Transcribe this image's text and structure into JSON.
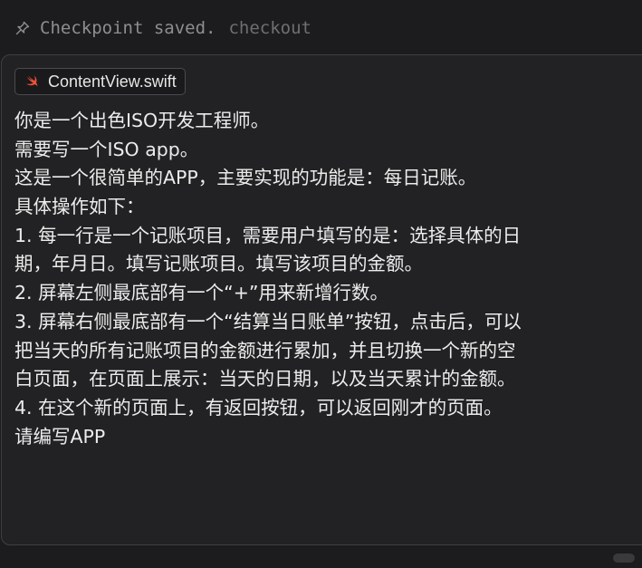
{
  "checkpoint": {
    "icon": "pin-icon",
    "text": "Checkpoint saved.",
    "link_label": "checkout"
  },
  "file_chip": {
    "icon": "swift-icon",
    "name": "ContentView.swift",
    "icon_color": "#f05138"
  },
  "prompt": {
    "lines": [
      "你是一个出色ISO开发工程师。",
      "需要写一个ISO app。",
      "这是一个很简单的APP，主要实现的功能是：每日记账。",
      "具体操作如下：",
      "1. 每一行是一个记账项目，需要用户填写的是：选择具体的日",
      "期，年月日。填写记账项目。填写该项目的金额。",
      "2. 屏幕左侧最底部有一个“+”用来新增行数。",
      "3. 屏幕右侧最底部有一个“结算当日账单”按钮，点击后，可以",
      "把当天的所有记账项目的金额进行累加，并且切换一个新的空",
      "白页面，在页面上展示：当天的日期，以及当天累计的金额。",
      "4. 在这个新的页面上，有返回按钮，可以返回刚才的页面。",
      "请编写APP"
    ]
  }
}
